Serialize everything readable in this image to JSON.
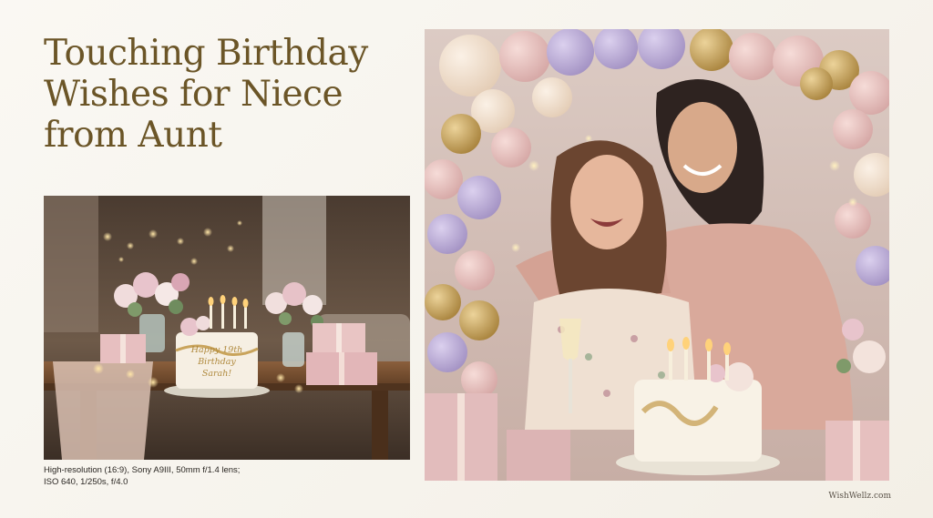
{
  "title": {
    "line1": "Touching Birthday",
    "line2": "Wishes for Niece",
    "line3": "from Aunt"
  },
  "cake_text": {
    "line1": "Happy 19th",
    "line2": "Birthday",
    "line3": "Sarah!"
  },
  "caption": {
    "line1": "High-resolution (16:9), Sony A9III, 50mm f/1.4 lens;",
    "line2": "ISO 640, 1/250s, f/4.0"
  },
  "watermark": "WishWellz.com",
  "colors": {
    "background": "#f8f6f1",
    "title": "#6b5527",
    "caption": "#2a2622",
    "sweater": "#d9a99b",
    "balloon_gold": "#c9a45c",
    "balloon_lilac": "#bba8d6",
    "balloon_blush": "#e9c2c0"
  },
  "images": [
    {
      "name": "birthday-table-scene",
      "description_icon": "cake-with-candles-icon"
    },
    {
      "name": "aunt-hugging-niece-scene",
      "description_icon": "balloon-arch-icon"
    }
  ]
}
